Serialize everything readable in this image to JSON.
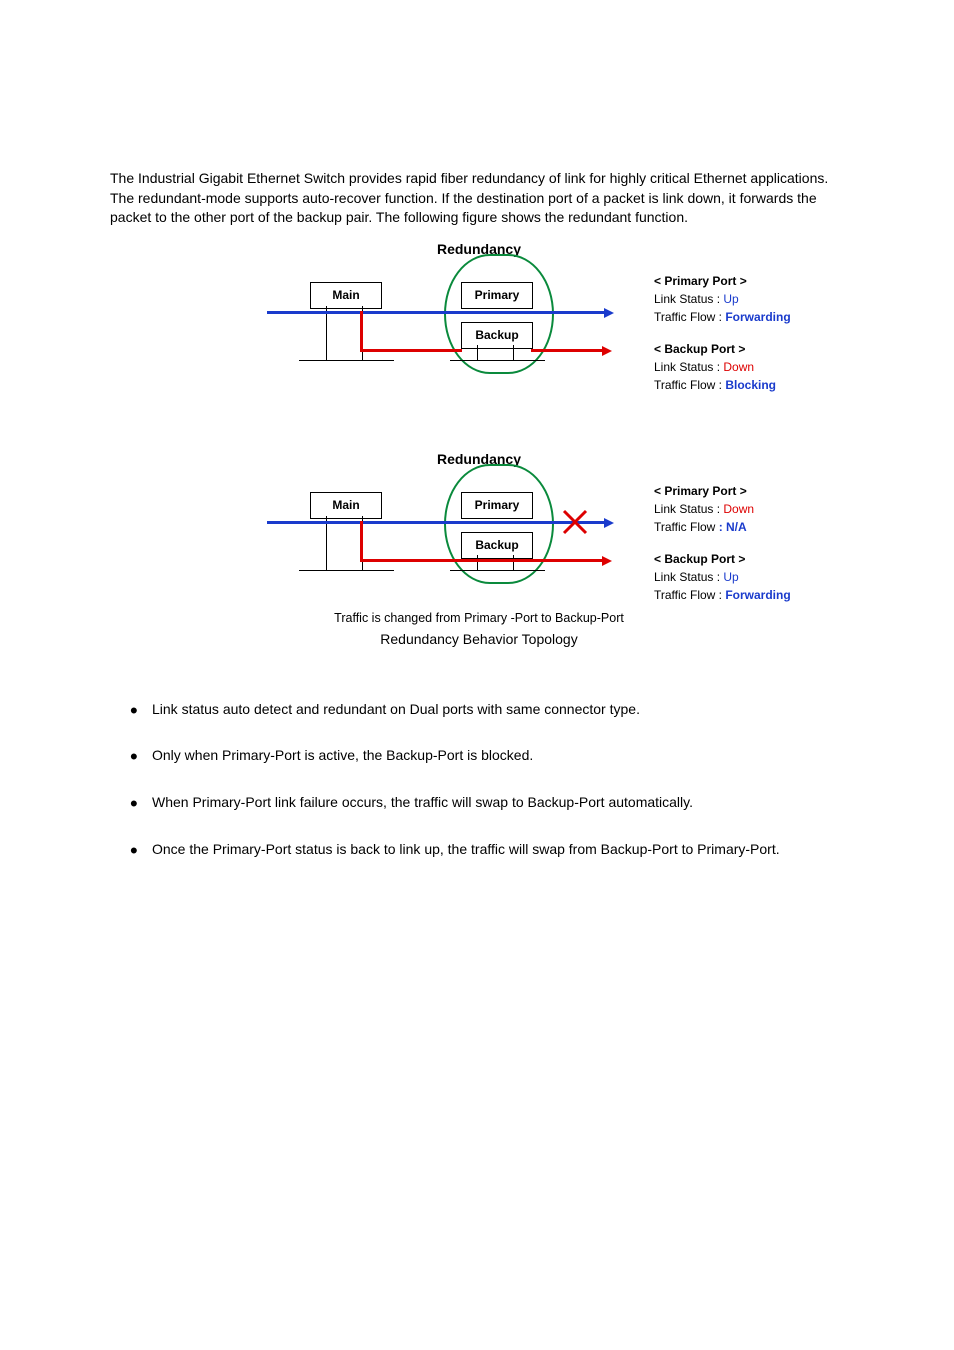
{
  "intro": "The Industrial Gigabit Ethernet Switch provides rapid fiber redundancy of link for highly critical Ethernet applications. The redundant-mode supports auto-recover function. If the destination port of a packet is link down, it forwards the packet to the other port of the backup pair. The following figure shows the redundant function.",
  "diagram1": {
    "title": "Redundancy",
    "main": "Main",
    "primary": "Primary",
    "backup": "Backup",
    "legend": {
      "pTitle": "< Primary Port >",
      "pLine1a": "Link Status  : ",
      "pLine1b": "Up",
      "pLine2a": "Traffic Flow : ",
      "pLine2b": "Forwarding",
      "bTitle": "< Backup Port >",
      "bLine1a": "Link Status  : ",
      "bLine1b": "Down",
      "bLine2a": "Traffic Flow : ",
      "bLine2b": "Blocking"
    }
  },
  "diagram2": {
    "title": "Redundancy",
    "main": "Main",
    "primary": "Primary",
    "backup": "Backup",
    "note": "Traffic is changed from Primary -Port to Backup-Port",
    "caption": "Redundancy Behavior Topology",
    "legend": {
      "pTitle": "< Primary Port >",
      "pLine1a": "Link Status  : ",
      "pLine1b": "Down",
      "pLine2a": "Traffic Flow ",
      "pLine2b": ": N/A",
      "bTitle": "< Backup Port >",
      "bLine1a": "Link Status  : ",
      "bLine1b": "Up",
      "bLine2a": "Traffic Flow : ",
      "bLine2b": "Forwarding"
    }
  },
  "bullets": {
    "b1": "Link status auto detect and redundant on Dual ports with same connector type.",
    "b2": "Only when Primary-Port is active, the Backup-Port is blocked.",
    "b3": "When Primary-Port link failure occurs, the traffic will swap to Backup-Port automatically.",
    "b4": "Once the Primary-Port status is back to link up, the traffic will swap from Backup-Port to Primary-Port."
  }
}
